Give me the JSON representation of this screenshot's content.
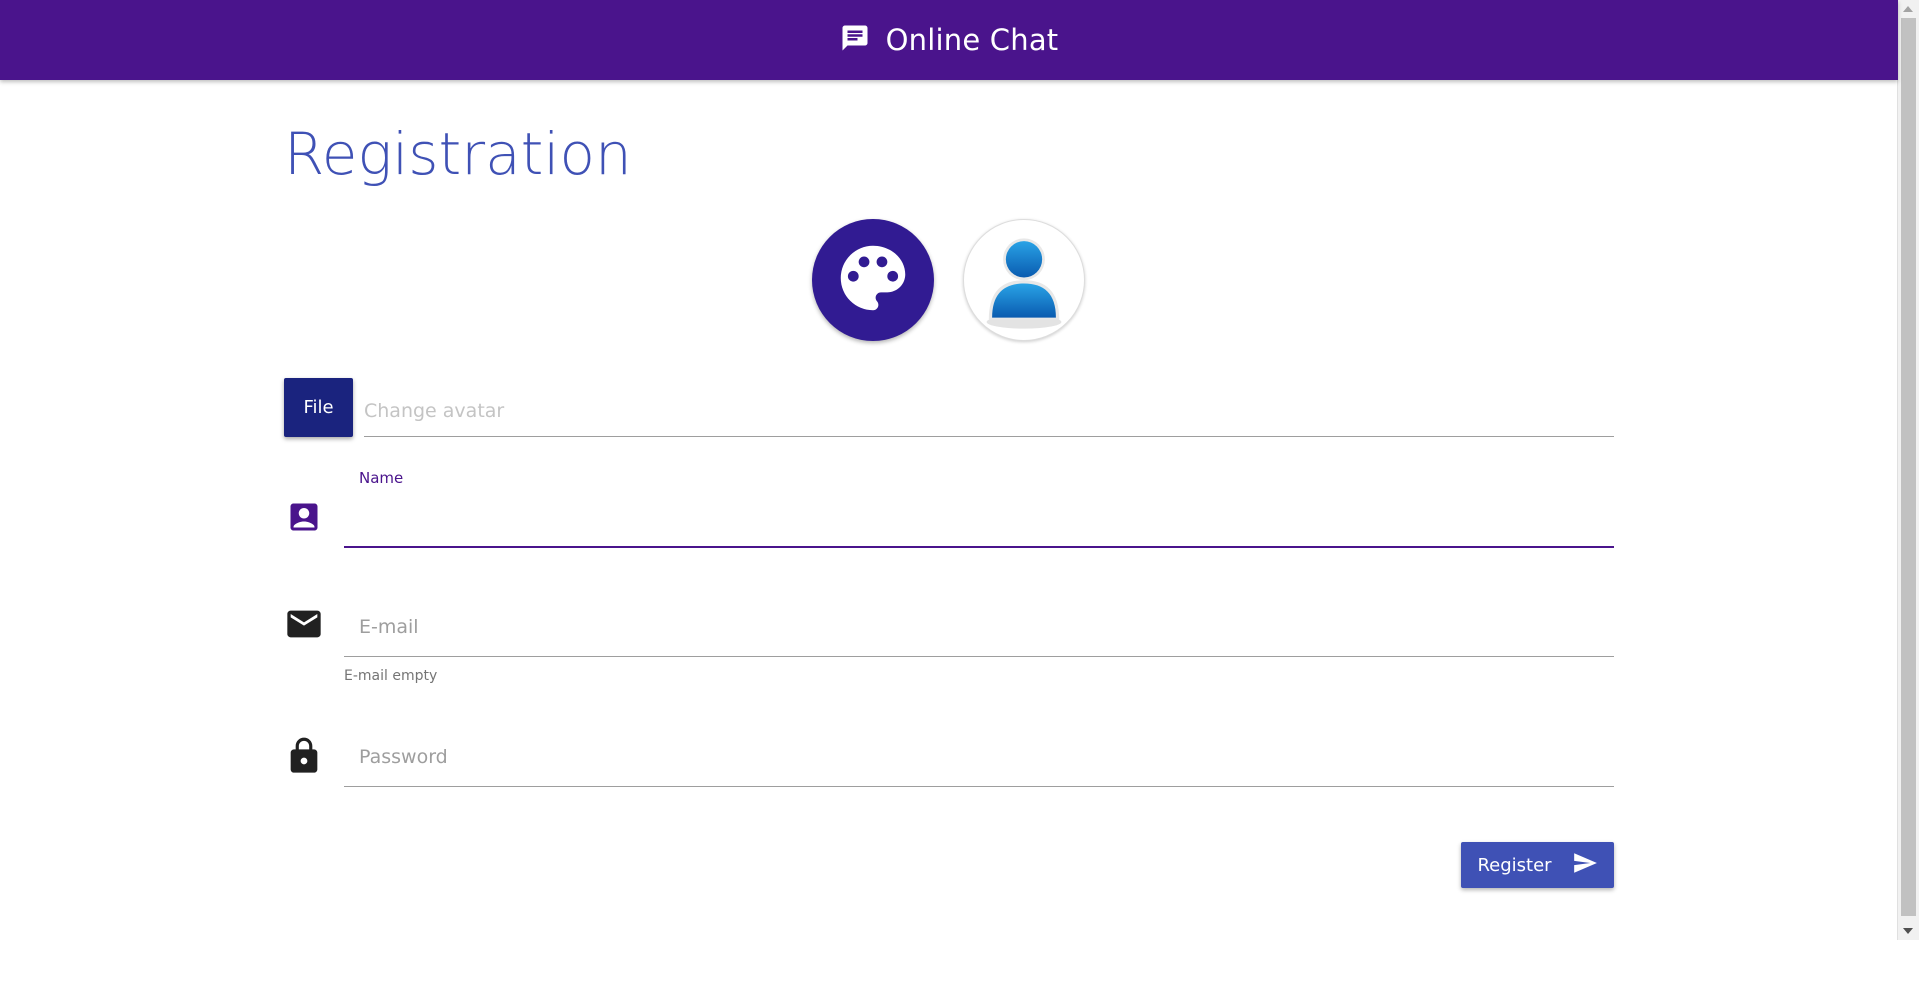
{
  "app": {
    "title": "Online Chat",
    "icons": {
      "header": "chat-icon",
      "palette": "palette-icon",
      "avatar": "user-avatar-icon",
      "name": "contact-card-icon",
      "email": "mail-icon",
      "password": "lock-icon",
      "send": "send-icon"
    },
    "colors": {
      "appbar": "#4a148c",
      "heading": "#3f51b5",
      "file_button": "#1a237e",
      "palette_avatar": "#311b92",
      "register_button": "#3f51b5",
      "active_field": "#4a148c"
    }
  },
  "registration": {
    "heading": "Registration",
    "file_button_label": "File",
    "avatar_field": {
      "placeholder": "Change avatar"
    },
    "name_field": {
      "label": "Name",
      "value": ""
    },
    "email_field": {
      "placeholder": "E-mail",
      "value": "",
      "helper": "E-mail empty"
    },
    "password_field": {
      "placeholder": "Password",
      "value": ""
    },
    "register_button_label": "Register"
  }
}
